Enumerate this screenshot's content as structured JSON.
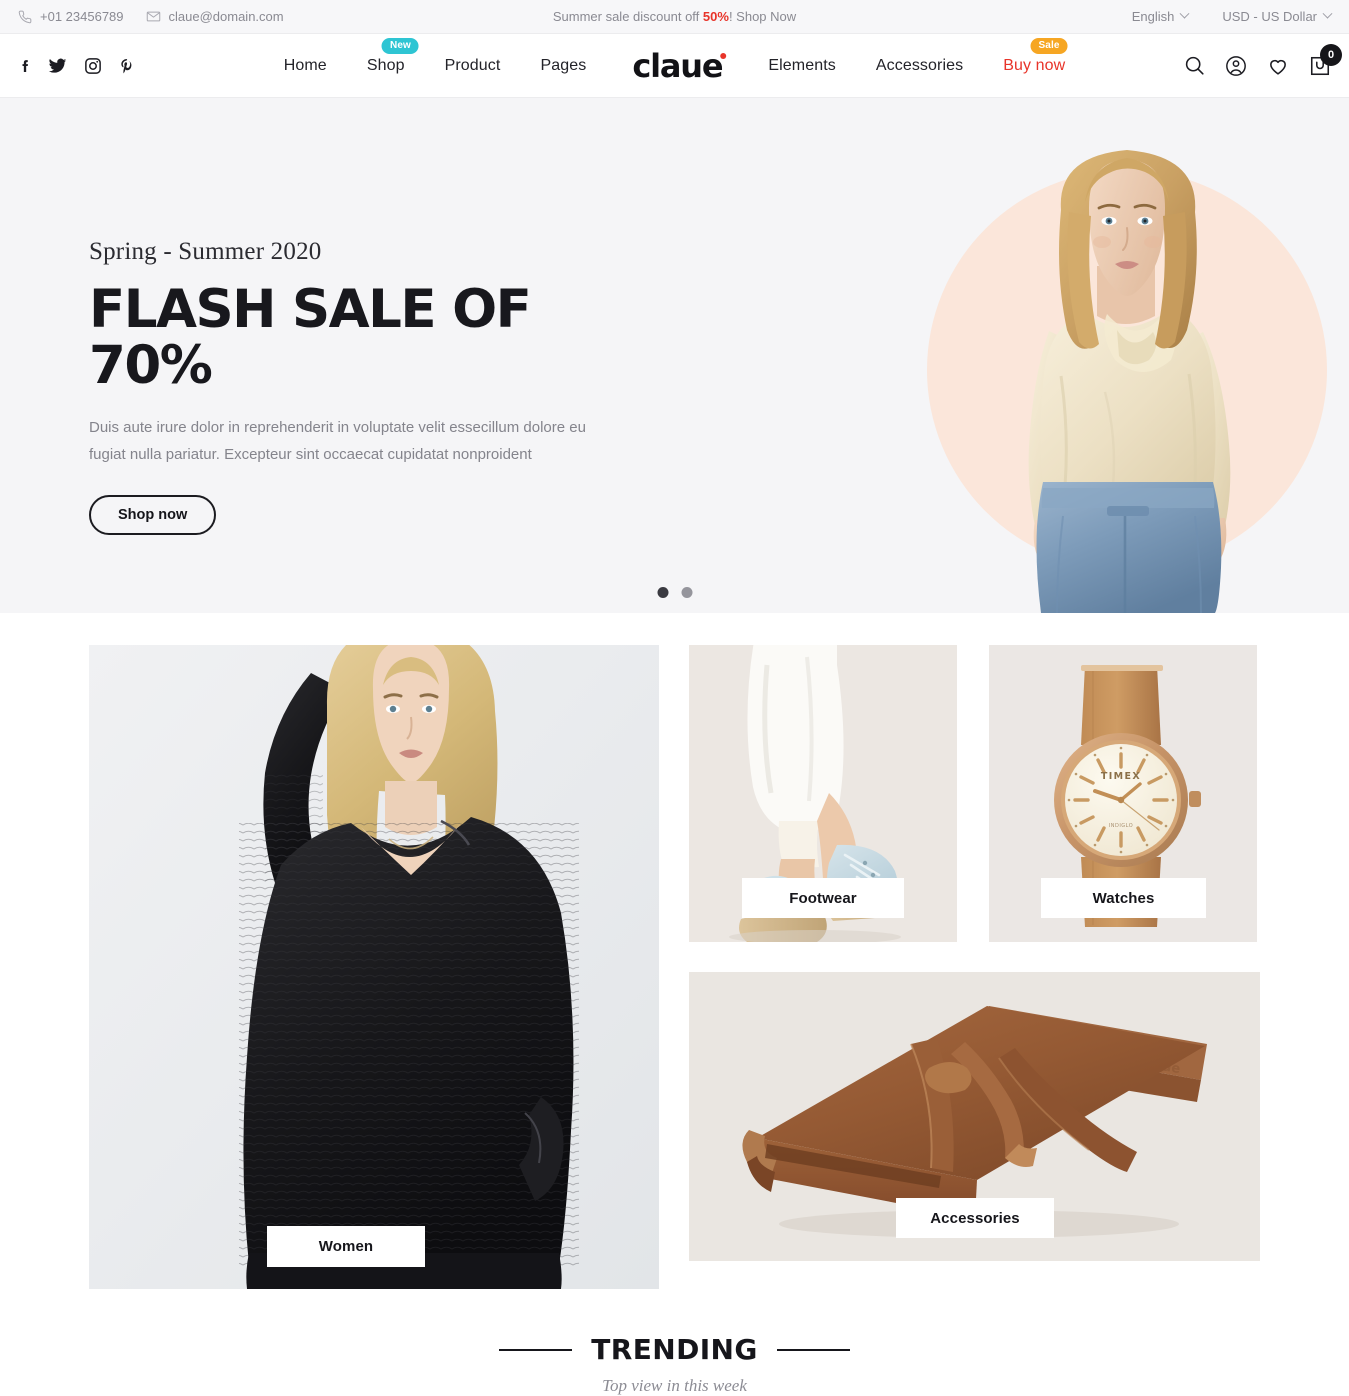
{
  "topbar": {
    "phone": "+01 23456789",
    "email": "claue@domain.com",
    "promo_pre": "Summer sale discount off ",
    "promo_pct": "50%",
    "promo_post": "! Shop Now",
    "language": "English",
    "currency": "USD - US Dollar"
  },
  "nav": {
    "social": [
      "facebook-icon",
      "twitter-icon",
      "instagram-icon",
      "pinterest-icon"
    ],
    "links": [
      {
        "label": "Home",
        "badge": null,
        "red": false
      },
      {
        "label": "Shop",
        "badge": "New",
        "red": false
      },
      {
        "label": "Product",
        "badge": null,
        "red": false
      },
      {
        "label": "Pages",
        "badge": null,
        "red": false
      }
    ],
    "logo": "claue",
    "links_right": [
      {
        "label": "Elements",
        "badge": null,
        "red": false
      },
      {
        "label": "Accessories",
        "badge": null,
        "red": false
      },
      {
        "label": "Buy now",
        "badge": "Sale",
        "red": true
      }
    ],
    "cart_count": "0",
    "icons": [
      "search-icon",
      "account-icon",
      "wishlist-heart-icon",
      "cart-icon"
    ]
  },
  "hero": {
    "eyebrow": "Spring - Summer 2020",
    "title": "FLASH SALE OF 70%",
    "description": "Duis aute irure dolor in reprehenderit in voluptate velit essecillum dolore eu fugiat nulla pariatur. Excepteur sint occaecat cupidatat nonproident",
    "cta": "Shop now",
    "slide_count": 2,
    "active_slide": 1
  },
  "categories": [
    {
      "label": "Women"
    },
    {
      "label": "Footwear"
    },
    {
      "label": "Watches"
    },
    {
      "label": "Accessories"
    }
  ],
  "trending": {
    "title": "TRENDING",
    "subtitle": "Top view in this week"
  },
  "colors": {
    "accent_red": "#e8342a",
    "badge_new": "#2ec5d3",
    "badge_sale": "#f6a623",
    "hero_bg": "#f5f5f7",
    "hero_circle": "#fbe6da",
    "ink": "#16161b"
  }
}
